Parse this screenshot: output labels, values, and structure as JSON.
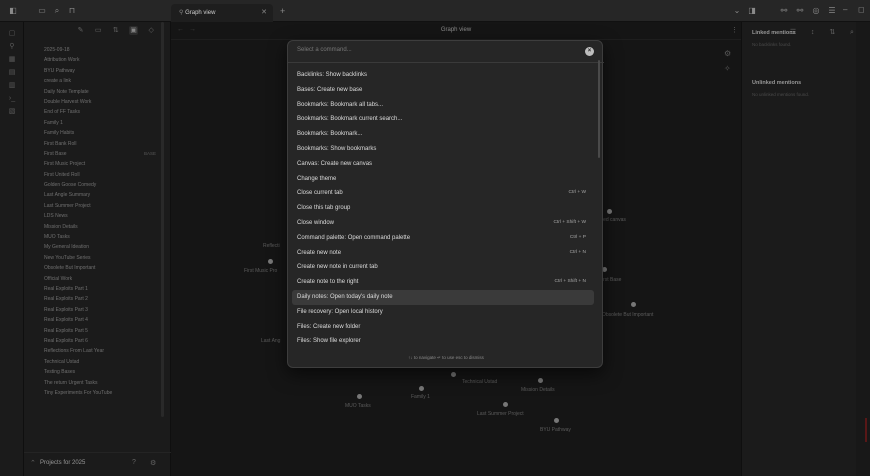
{
  "tab": {
    "title": "Graph view"
  },
  "view": {
    "title": "Graph view"
  },
  "sidebar": {
    "files": [
      "2025-09-18",
      "Attribution Work",
      "BYU Pathway",
      "create a link",
      "Daily Note Template",
      "Double Harvest Work",
      "End of FF Tasks",
      "Family 1",
      "Family Habits",
      "First Bank Roll",
      "First Base",
      "First Music Project",
      "First United Roll",
      "Golden Goose Comedy",
      "Last Angle Summary",
      "Last Summer Project",
      "LDS News",
      "Mission Details",
      "MUO Tasks",
      "My General Ideation",
      "New YouTube Series",
      "Obsolete But Important",
      "Official Work",
      "Real Exploits Part 1",
      "Real Exploits Part 2",
      "Real Exploits Part 3",
      "Real Exploits Part 4",
      "Real Exploits Part 5",
      "Real Exploits Part 6",
      "Reflections From Last Year",
      "Technical Ustad",
      "Testing Bases",
      "The return Urgent Tasks",
      "Tiny Experiments For YouTube"
    ],
    "first_base_badge": "BASE",
    "vault_name": "Projects for 2025"
  },
  "graph_labels": {
    "reflections": "Reflecti",
    "first_music": "First Music Pro",
    "last_angle": "Last Ang",
    "technical_ustad": "Technical Ustad",
    "mission_details": "Mission Details",
    "family1": "Family 1",
    "muo_tasks": "MUO Tasks",
    "last_summer": "Last Summer Project",
    "byu": "BYU Pathway",
    "obsolete": "Obsolete But Important",
    "canvas": "led canvas",
    "base": "irst Base"
  },
  "right_panel": {
    "linked_title": "Linked mentions",
    "linked_sub": "No backlinks found.",
    "unlinked_title": "Unlinked mentions",
    "unlinked_sub": "No unlinked mentions found."
  },
  "palette": {
    "placeholder": "Select a command...",
    "commands": [
      {
        "label": "Backlinks: Show backlinks",
        "hotkey": ""
      },
      {
        "label": "Bases: Create new base",
        "hotkey": ""
      },
      {
        "label": "Bookmarks: Bookmark all tabs...",
        "hotkey": ""
      },
      {
        "label": "Bookmarks: Bookmark current search...",
        "hotkey": ""
      },
      {
        "label": "Bookmarks: Bookmark...",
        "hotkey": ""
      },
      {
        "label": "Bookmarks: Show bookmarks",
        "hotkey": ""
      },
      {
        "label": "Canvas: Create new canvas",
        "hotkey": ""
      },
      {
        "label": "Change theme",
        "hotkey": ""
      },
      {
        "label": "Close current tab",
        "hotkey": "Ctrl + W"
      },
      {
        "label": "Close this tab group",
        "hotkey": ""
      },
      {
        "label": "Close window",
        "hotkey": "Ctrl + Shift + W"
      },
      {
        "label": "Command palette: Open command palette",
        "hotkey": "Ctrl + P"
      },
      {
        "label": "Create new note",
        "hotkey": "Ctrl + N"
      },
      {
        "label": "Create new note in current tab",
        "hotkey": ""
      },
      {
        "label": "Create note to the right",
        "hotkey": "Ctrl + Shift + N"
      },
      {
        "label": "Daily notes: Open today's daily note",
        "hotkey": ""
      },
      {
        "label": "File recovery: Open local history",
        "hotkey": ""
      },
      {
        "label": "Files: Create new folder",
        "hotkey": ""
      },
      {
        "label": "Files: Show file explorer",
        "hotkey": ""
      }
    ],
    "selected_index": 15,
    "footer": "↑↓ to navigate   ↵ to use   esc to dismiss"
  }
}
